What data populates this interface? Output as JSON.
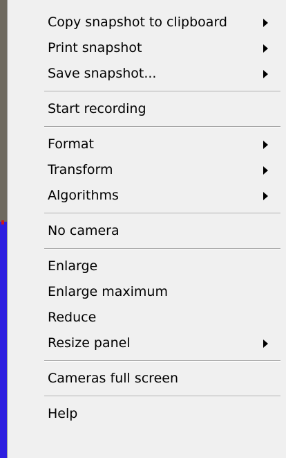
{
  "menu": {
    "items": [
      {
        "type": "item",
        "label": "Copy snapshot to clipboard",
        "submenu": true
      },
      {
        "type": "item",
        "label": "Print snapshot",
        "submenu": true
      },
      {
        "type": "item",
        "label": "Save snapshot...",
        "submenu": true
      },
      {
        "type": "separator"
      },
      {
        "type": "item",
        "label": "Start recording",
        "submenu": false
      },
      {
        "type": "separator"
      },
      {
        "type": "item",
        "label": "Format",
        "submenu": true
      },
      {
        "type": "item",
        "label": "Transform",
        "submenu": true
      },
      {
        "type": "item",
        "label": "Algorithms",
        "submenu": true
      },
      {
        "type": "separator"
      },
      {
        "type": "item",
        "label": "No camera",
        "submenu": false
      },
      {
        "type": "separator"
      },
      {
        "type": "item",
        "label": "Enlarge",
        "submenu": false
      },
      {
        "type": "item",
        "label": "Enlarge maximum",
        "submenu": false
      },
      {
        "type": "item",
        "label": "Reduce",
        "submenu": false
      },
      {
        "type": "item",
        "label": "Resize panel",
        "submenu": true
      },
      {
        "type": "separator"
      },
      {
        "type": "item",
        "label": "Cameras full screen",
        "submenu": false
      },
      {
        "type": "separator"
      },
      {
        "type": "item",
        "label": "Help",
        "submenu": false
      }
    ]
  }
}
